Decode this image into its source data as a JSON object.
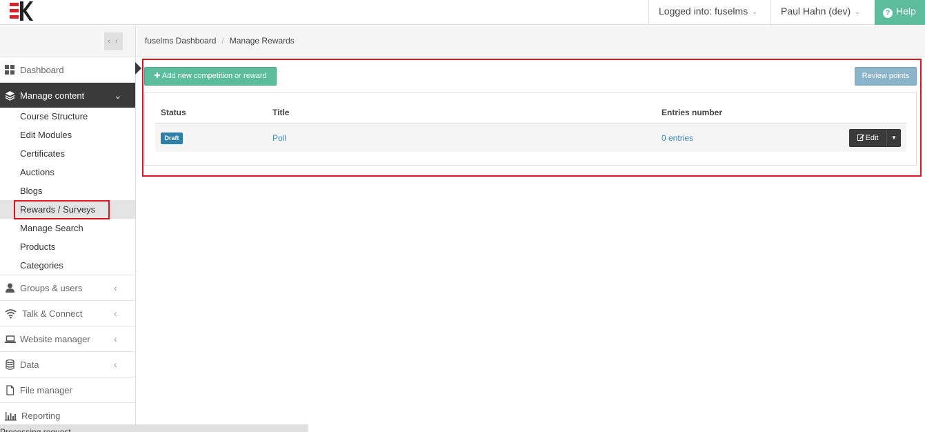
{
  "topbar": {
    "logged_into": "Logged into: fuselms",
    "user": "Paul Hahn (dev)",
    "help": "Help"
  },
  "breadcrumb": {
    "items": [
      "fuselms Dashboard",
      "Manage Rewards"
    ]
  },
  "sidebar": {
    "nav": [
      {
        "label": "Dashboard",
        "icon": "dashboard-icon"
      },
      {
        "label": "Manage content",
        "icon": "layers-icon"
      },
      {
        "label": "Groups & users",
        "icon": "user-icon"
      },
      {
        "label": "Talk & Connect",
        "icon": "wifi-icon"
      },
      {
        "label": "Website manager",
        "icon": "laptop-icon"
      },
      {
        "label": "Data",
        "icon": "database-icon"
      },
      {
        "label": "File manager",
        "icon": "file-icon"
      },
      {
        "label": "Reporting",
        "icon": "bar-chart-icon"
      }
    ],
    "sub_items": [
      "Course Structure",
      "Edit Modules",
      "Certificates",
      "Auctions",
      "Blogs",
      "Rewards / Surveys",
      "Manage Search",
      "Products",
      "Categories"
    ]
  },
  "main": {
    "add_button": "Add new competition or reward",
    "review_button": "Review points",
    "table": {
      "headers": [
        "Status",
        "Title",
        "Entries number"
      ],
      "rows": [
        {
          "status": "Draft",
          "title": "Poll",
          "entries": "0 entries",
          "action": "Edit"
        }
      ]
    }
  },
  "status_bar": "Processing request...",
  "colors": {
    "accent_green": "#5cbd9d",
    "dark_nav": "#3a3a3a",
    "highlight_red": "#e0141e",
    "badge_blue": "#2f7fab",
    "link_blue": "#3a8ac4"
  }
}
